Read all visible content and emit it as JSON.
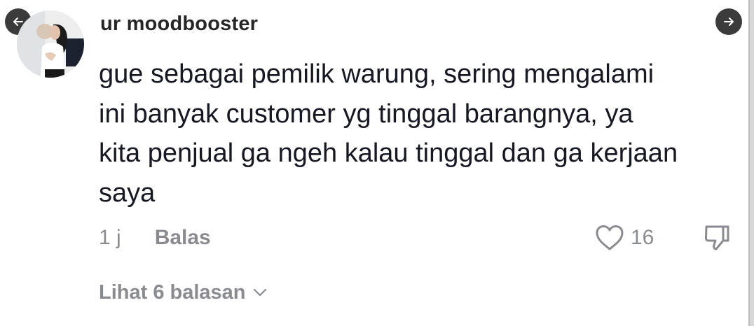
{
  "comment": {
    "username": "ur moodbooster",
    "text": "gue sebagai pemilik warung, sering mengalami ini banyak customer yg tinggal barangnya, ya kita penjual ga ngeh kalau tinggal dan ga kerjaan saya",
    "lines": [
      "gue sebagai pemilik warung, sering mengalami",
      "ini banyak customer yg tinggal barangnya, ya",
      "kita penjual ga ngeh kalau tinggal dan ga kerjaan",
      "saya"
    ],
    "time": "1 j",
    "reply_label": "Balas",
    "like_count": "16",
    "view_replies_label": "Lihat 6 balasan"
  },
  "icons": {
    "prev": "arrow-left-icon",
    "next": "arrow-right-icon",
    "like": "heart-outline-icon",
    "dislike": "thumbs-down-icon",
    "expand": "chevron-down-icon"
  },
  "colors": {
    "text_primary": "#161823",
    "text_secondary": "#8a8b91",
    "nav_button": "#3b3b3b"
  }
}
